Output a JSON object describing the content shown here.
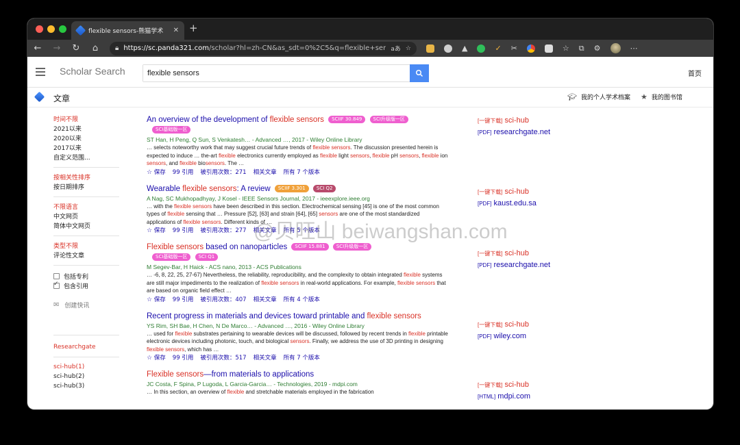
{
  "browser": {
    "tab_title": "flexible sensors-熊猫学术",
    "tab_close": "✕",
    "new_tab": "+",
    "url_host": "https://sc.panda321.com",
    "url_path": "/scholar?hl=zh-CN&as_sdt=0%2C5&q=flexible+sens..."
  },
  "header": {
    "logo": "Scholar Search",
    "search_value": "flexible sensors",
    "home": "首页"
  },
  "subheader": {
    "title": "文章",
    "profile": "我的个人学术档案",
    "library": "我的图书馆"
  },
  "sidebar": {
    "time": [
      "时间不限",
      "2021以来",
      "2020以来",
      "2017以来",
      "自定义范围..."
    ],
    "sort": [
      "按相关性排序",
      "按日期排序"
    ],
    "lang": [
      "不限语言",
      "中文网页",
      "简体中文网页"
    ],
    "type": [
      "类型不限",
      "评论性文章"
    ],
    "patents": "包括专利",
    "citations": "包含引用",
    "alert": "创建快讯",
    "links": [
      "Researchgate",
      "sci-hub(1)",
      "sci-hub(2)",
      "sci-hub(3)"
    ]
  },
  "results": [
    {
      "title_pre": "An overview of the development of ",
      "title_hl": "flexible sensors",
      "title_post": "",
      "badges": [
        "SCIIF 30.849",
        "SCI升级版一区",
        "SCI基础版一区"
      ],
      "authors": "ST Han, H Peng, Q Sun, S Venkatesh… - Advanced …, 2017 - Wiley Online Library",
      "snippet": "… selects noteworthy work that may suggest crucial future trends of flexible sensors. The discussion presented herein is expected to induce … the-art flexible electronics currently employed as flexible light sensors, flexible pH sensors, flexible ion sensors, and flexible biosensors. The …",
      "save": "保存",
      "cite": "引用",
      "cited_by": "被引用次数：271",
      "related": "相关文章",
      "versions": "所有 7 个版本",
      "dl_label": "[一键下载]",
      "dl_link": "sci-hub",
      "src_label": "[PDF]",
      "src_link": "researchgate.net"
    },
    {
      "title_pre": "Wearable ",
      "title_hl": "flexible sensors",
      "title_post": ": A review",
      "badges": [
        "SCIIF 3.301",
        "SCI Q2"
      ],
      "authors": "A Nag, SC Mukhopadhyay, J Kosel - IEEE Sensors Journal, 2017 - ieeexplore.ieee.org",
      "snippet": "… with the flexible sensors have been described in this section. Electrochemical sensing [45] is one of the most common types of flexible sensing that … Pressure [52], [63] and strain [64], [65] sensors are one of the most standardized applications of flexible sensors. Different kinds of …",
      "save": "保存",
      "cite": "引用",
      "cited_by": "被引用次数：277",
      "related": "相关文章",
      "versions": "所有 5 个版本",
      "dl_label": "[一键下载]",
      "dl_link": "sci-hub",
      "src_label": "[PDF]",
      "src_link": "kaust.edu.sa"
    },
    {
      "title_pre": "",
      "title_hl": "Flexible sensors",
      "title_post": " based on nanoparticles",
      "badges": [
        "SCIIF 15.881",
        "SCI升级版一区",
        "SCI基础版一区",
        "SCI Q1"
      ],
      "authors": "M Segev-Bar, H Haick - ACS nano, 2013 - ACS Publications",
      "snippet": "… -6, 8, 22, 25, 27-67) Nevertheless, the reliability, reproducibility, and the complexity to obtain integrated flexible systems are still major impediments to the realization of flexible sensors in real-world applications. For example, flexible sensors that are based on organic field effect …",
      "save": "保存",
      "cite": "引用",
      "cited_by": "被引用次数：407",
      "related": "相关文章",
      "versions": "所有 4 个版本",
      "dl_label": "[一键下载]",
      "dl_link": "sci-hub",
      "src_label": "[PDF]",
      "src_link": "researchgate.net"
    },
    {
      "title_pre": "Recent progress in materials and devices toward printable and ",
      "title_hl": "flexible sensors",
      "title_post": "",
      "badges": [],
      "authors": "YS Rim, SH Bae, H Chen, N De Marco… - Advanced …, 2016 - Wiley Online Library",
      "snippet": "… used for flexible substrates pertaining to wearable devices will be discussed, followed by recent trends in flexible printable electronic devices including photonic, touch, and biological sensors. Finally, we address the use of 3D printing in designing flexible sensors, which has …",
      "save": "保存",
      "cite": "引用",
      "cited_by": "被引用次数：517",
      "related": "相关文章",
      "versions": "所有 7 个版本",
      "dl_label": "[一键下载]",
      "dl_link": "sci-hub",
      "src_label": "[PDF]",
      "src_link": "wiley.com"
    },
    {
      "title_pre": "",
      "title_hl": "Flexible sensors",
      "title_post": "—from materials to applications",
      "badges": [],
      "authors": "JC Costa, F Spina, P Lugoda, L Garcia-Garcia… - Technologies, 2019 - mdpi.com",
      "snippet": "… In this section, an overview of flexible and stretchable materials employed in the fabrication",
      "save": "",
      "cite": "",
      "cited_by": "",
      "related": "",
      "versions": "",
      "dl_label": "[一键下载]",
      "dl_link": "sci-hub",
      "src_label": "[HTML]",
      "src_link": "mdpi.com"
    }
  ],
  "watermark": "@贝旺山 beiwangshan.com",
  "colors": {
    "accent": "#4a8af4",
    "link": "#1a0dab",
    "highlight": "#d93025",
    "badge_pink": "#ef5fcf"
  }
}
